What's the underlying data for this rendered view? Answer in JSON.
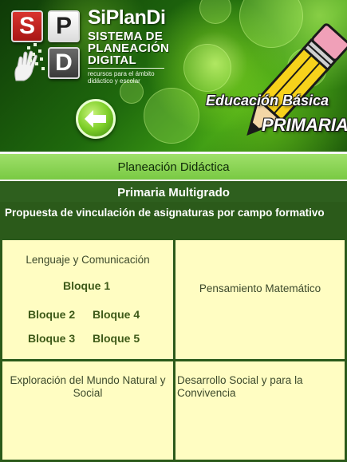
{
  "header": {
    "tiles": [
      "S",
      "P",
      "D"
    ],
    "brand_title": "SiPlanDi",
    "brand_lines": [
      "SISTEMA DE",
      "PLANEACIÓN",
      "DIGITAL"
    ],
    "tagline_lines": [
      "recursos para el ámbito",
      "didáctico y escolar"
    ],
    "education": "Educación Básica",
    "level": "PRIMARIA",
    "back_icon": "back-arrow-icon"
  },
  "nav": {
    "title": "Planeación Didáctica"
  },
  "section": {
    "title": "Primaria Multigrado",
    "description": "Propuesta de vinculación de asignaturas por campo formativo"
  },
  "areas": {
    "lenguaje": {
      "label": "Lenguaje y Comunicación",
      "bloques": [
        "Bloque 1",
        "Bloque 2",
        "Bloque 4",
        "Bloque 3",
        "Bloque 5"
      ]
    },
    "matematico": {
      "label": "Pensamiento Matemático"
    },
    "exploracion": {
      "label": "Exploración del Mundo Natural y Social"
    },
    "desarrollo": {
      "label": "Desarrollo Social y para la Convivencia"
    }
  },
  "colors": {
    "nav_bar": "#8fd659",
    "subhead": "#2e5f1e",
    "cell_bg": "#fffdc2",
    "bloque_text": "#3e5a18",
    "tile_s": "#c2201d",
    "tile_d": "#4a4a4a"
  }
}
